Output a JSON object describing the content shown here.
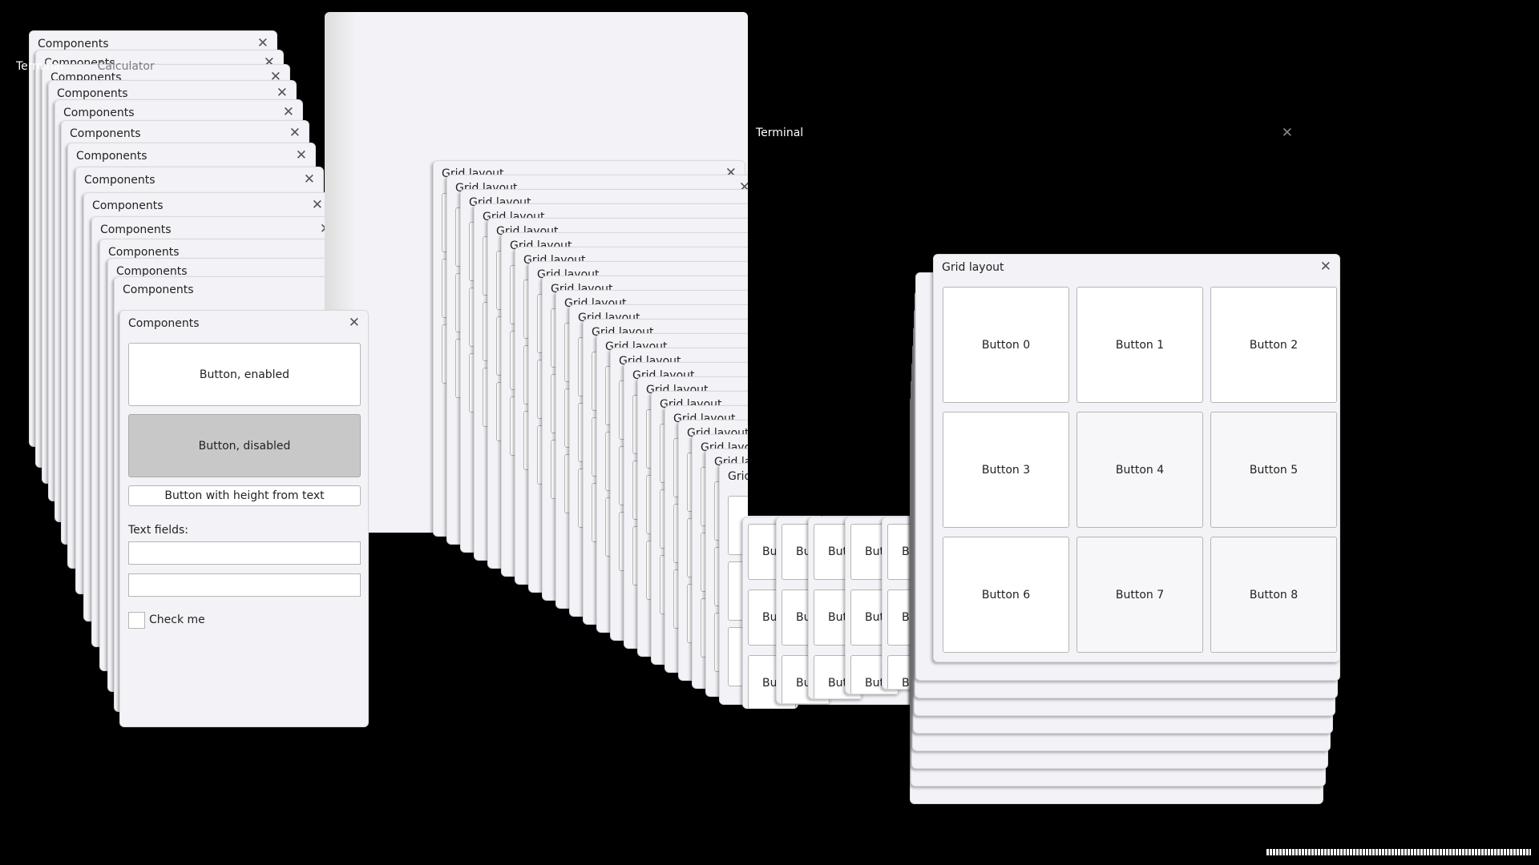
{
  "taskbar": {
    "items": [
      "Terminal",
      "Calculator"
    ]
  },
  "components": {
    "title": "Components",
    "close": "✕",
    "button_enabled": "Button, enabled",
    "button_disabled": "Button, disabled",
    "button_text_height": "Button with height from text",
    "text_fields_label": "Text fields:",
    "text_field_1": "",
    "text_field_2": "",
    "checkbox_label": "Check me",
    "checkbox_checked": false
  },
  "terminal": {
    "title": "Terminal",
    "close": "✕"
  },
  "grid": {
    "title": "Grid layout",
    "close": "✕",
    "buttons": [
      "Button 0",
      "Button 1",
      "Button 2",
      "Button 3",
      "Button 4",
      "Button 5",
      "Button 6",
      "Button 7",
      "Button 8"
    ],
    "truncated_button": "But"
  }
}
